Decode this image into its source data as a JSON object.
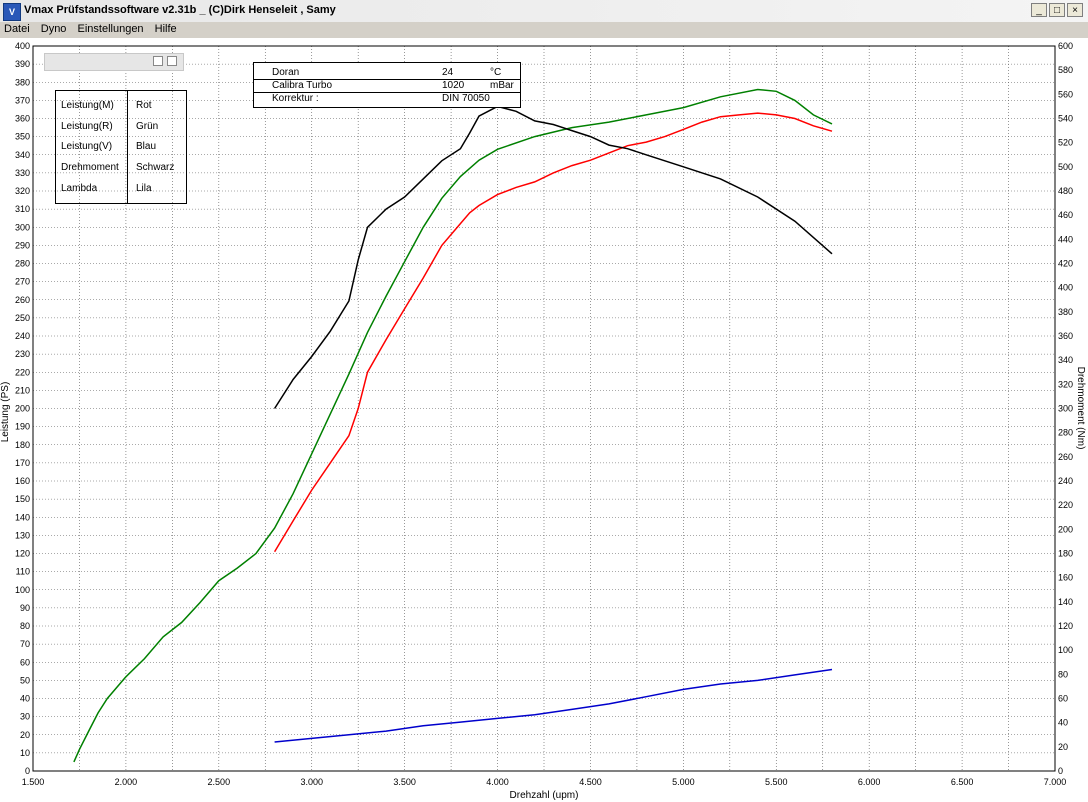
{
  "window": {
    "title": "Vmax Prüfstandssoftware v2.31b _ (C)Dirk Henseleit , Samy",
    "min_label": "_",
    "max_label": "□",
    "close_label": "×"
  },
  "menu": [
    "Datei",
    "Dyno",
    "Einstellungen",
    "Hilfe"
  ],
  "legend": [
    {
      "name": "Leistung(M)",
      "color": "Rot"
    },
    {
      "name": "Leistung(R)",
      "color": "Grün"
    },
    {
      "name": "Leistung(V)",
      "color": "Blau"
    },
    {
      "name": "Drehmoment",
      "color": "Schwarz"
    },
    {
      "name": "Lambda",
      "color": "Lila"
    }
  ],
  "info": [
    {
      "label": "Doran",
      "value": "24",
      "unit": "°C"
    },
    {
      "label": "Calibra Turbo",
      "value": "1020",
      "unit": "mBar"
    },
    {
      "label": "Korrektur :",
      "value": "DIN 70050",
      "unit": ""
    }
  ],
  "colors": {
    "red": "#ff0000",
    "green": "#008000",
    "blue": "#0000cc",
    "black": "#000000",
    "grid": "#555555"
  },
  "chart_data": {
    "type": "line",
    "xlabel": "Drehzahl (upm)",
    "ylabel": "Leistung (PS)",
    "y2label": "Drehmoment (Nm)",
    "xlim": [
      1500,
      7000
    ],
    "ylim": [
      0,
      400
    ],
    "y2lim": [
      0,
      600
    ],
    "x_ticks": [
      "1.500",
      "2.000",
      "2.500",
      "3.000",
      "3.500",
      "4.000",
      "4.500",
      "5.000",
      "5.500",
      "6.000",
      "6.500",
      "7.000"
    ],
    "grid": true,
    "series": [
      {
        "name": "Leistung(M)",
        "color": "#ff0000",
        "axis": "left",
        "x": [
          2800,
          2900,
          3000,
          3100,
          3200,
          3250,
          3300,
          3400,
          3500,
          3600,
          3700,
          3800,
          3850,
          3900,
          4000,
          4100,
          4200,
          4300,
          4400,
          4500,
          4600,
          4700,
          4800,
          4900,
          5000,
          5100,
          5200,
          5300,
          5400,
          5500,
          5600,
          5700,
          5800
        ],
        "y": [
          121,
          138,
          155,
          170,
          185,
          200,
          220,
          238,
          255,
          272,
          290,
          302,
          308,
          312,
          318,
          322,
          325,
          330,
          334,
          337,
          341,
          345,
          347,
          350,
          354,
          358,
          361,
          362,
          363,
          362,
          360,
          356,
          353
        ]
      },
      {
        "name": "Leistung(R)",
        "color": "#008000",
        "axis": "left",
        "x": [
          1720,
          1750,
          1800,
          1850,
          1900,
          2000,
          2100,
          2200,
          2300,
          2400,
          2500,
          2600,
          2700,
          2800,
          2900,
          3000,
          3100,
          3200,
          3300,
          3400,
          3500,
          3600,
          3700,
          3800,
          3900,
          4000,
          4200,
          4400,
          4600,
          4800,
          5000,
          5200,
          5400,
          5500,
          5600,
          5700,
          5800
        ],
        "y": [
          5,
          12,
          22,
          32,
          40,
          52,
          62,
          74,
          82,
          93,
          105,
          112,
          120,
          134,
          153,
          175,
          197,
          219,
          242,
          262,
          281,
          300,
          316,
          328,
          337,
          343,
          350,
          355,
          358,
          362,
          366,
          372,
          376,
          375,
          370,
          362,
          357
        ]
      },
      {
        "name": "Leistung(V)",
        "color": "#0000cc",
        "axis": "left",
        "x": [
          2800,
          3000,
          3200,
          3400,
          3600,
          3800,
          4000,
          4200,
          4400,
          4600,
          4800,
          5000,
          5200,
          5400,
          5600,
          5800
        ],
        "y": [
          16,
          18,
          20,
          22,
          25,
          27,
          29,
          31,
          34,
          37,
          41,
          45,
          48,
          50,
          53,
          56
        ]
      },
      {
        "name": "Drehmoment",
        "color": "#000000",
        "axis": "right",
        "x": [
          2800,
          2900,
          3000,
          3100,
          3200,
          3250,
          3300,
          3400,
          3500,
          3600,
          3700,
          3800,
          3850,
          3900,
          4000,
          4100,
          4200,
          4300,
          4400,
          4500,
          4600,
          4700,
          4800,
          4900,
          5000,
          5200,
          5400,
          5600,
          5800
        ],
        "y": [
          300,
          324,
          343,
          364,
          389,
          423,
          450,
          465,
          475,
          490,
          505,
          515,
          528,
          542,
          550,
          546,
          538,
          535,
          530,
          525,
          518,
          515,
          510,
          505,
          500,
          490,
          475,
          455,
          428
        ]
      }
    ]
  }
}
